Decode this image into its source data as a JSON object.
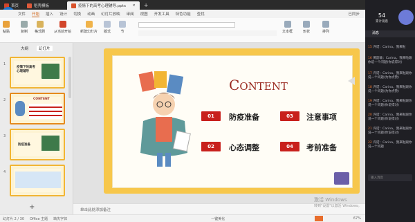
{
  "titlebar": {
    "tabs": [
      {
        "label": "首页",
        "active": false,
        "color": "#d2452a"
      },
      {
        "label": "稻壳模板",
        "active": false,
        "color": "#e05a3a"
      },
      {
        "label": "疫情下的高考心理辅导.pptx",
        "active": true,
        "color": "#d9522b"
      }
    ]
  },
  "avatar": {
    "initials": "Ca"
  },
  "menu": {
    "items": [
      "文件",
      "开始",
      "插入",
      "设计",
      "切换",
      "动画",
      "幻灯片放映",
      "审阅",
      "视图",
      "开发工具",
      "特色功能",
      "查找"
    ],
    "selected": "开始",
    "right": "已同步"
  },
  "toolbar": {
    "paste": "粘贴",
    "copy": "复制",
    "format": "格式刷",
    "from_current": "从当前开始",
    "new_slide": "新建幻灯片",
    "layout": "版式",
    "section": "节",
    "textbox": "文本框",
    "shape": "形状",
    "arrange": "排列"
  },
  "leftpanel": {
    "tabs": [
      "大纲",
      "幻灯片"
    ],
    "active_tab": "幻灯片",
    "slides": [
      {
        "num": "1",
        "title": "疫情下的高考心理辅导"
      },
      {
        "num": "2",
        "title": "CONTENT"
      },
      {
        "num": "3",
        "title": "防疫准备"
      },
      {
        "num": "4",
        "title": ""
      }
    ]
  },
  "slide": {
    "title_first": "C",
    "title_rest": "ONTENT",
    "items": [
      {
        "num": "01",
        "label": "防疫准备"
      },
      {
        "num": "03",
        "label": "注意事项"
      },
      {
        "num": "02",
        "label": "心态调整"
      },
      {
        "num": "04",
        "label": "考前准备"
      }
    ]
  },
  "notes": {
    "placeholder": "单击此处添加备注"
  },
  "status": {
    "slide": "幻灯片 2 / 30",
    "theme": "Office 主题",
    "font": "缺失字体",
    "beautify": "一键美化",
    "zoom": "67%"
  },
  "watermark": {
    "line1": "激活 Windows",
    "line2": "转到\"设置\"以激活 Windows。"
  },
  "rightpanel": {
    "viewers": "54",
    "viewers_label": "累计观看",
    "tab": "消息",
    "messages": [
      {
        "num": "15",
        "text": "许诺：Carina，我来啦"
      },
      {
        "num": "16",
        "text": "黄韵瑜：Carina，我来啦跟你说一个问题(你说得对)"
      },
      {
        "num": "17",
        "text": "许诺：Carina，我来啦跟你说一个问题(为你点赞)"
      },
      {
        "num": "18",
        "text": "许诺：Carina，我来啦跟你说一个问题(为你点赞)"
      },
      {
        "num": "19",
        "text": "许诺：Carina，我来啦跟你说一个问题(你说得对)"
      },
      {
        "num": "20",
        "text": "许诺：Carina，我来啦跟你说一个问题(你说得对)"
      },
      {
        "num": "21",
        "text": "许诺：Carina，我来啦跟你说一个问题(你说得对)"
      },
      {
        "num": "22",
        "text": "许诺：Carina，我来啦跟你说一个问题"
      }
    ],
    "input_placeholder": "输入消息"
  },
  "colors": {
    "accent": "#c8201c",
    "border": "#f2b533",
    "panel": "#1f1f24"
  }
}
